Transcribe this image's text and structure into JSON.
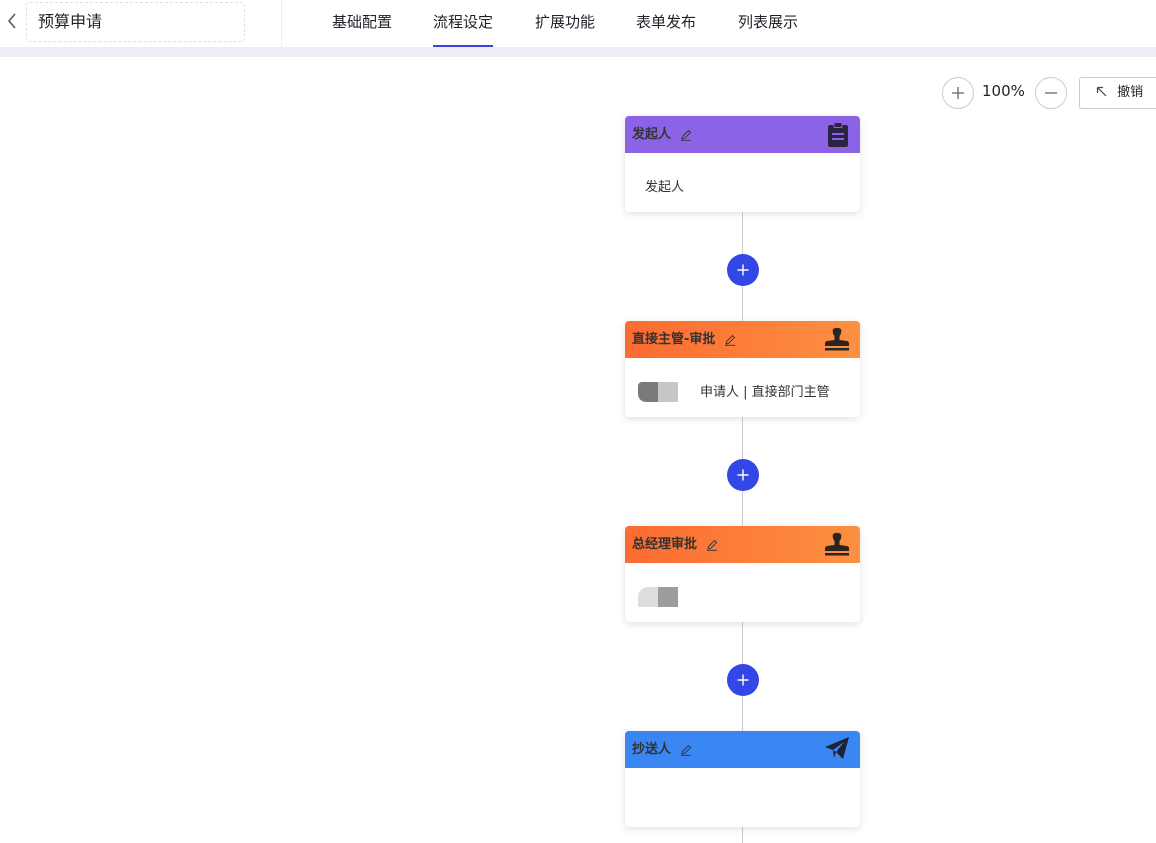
{
  "header": {
    "title": "预算申请",
    "tabs": [
      {
        "label": "基础配置",
        "active": false
      },
      {
        "label": "流程设定",
        "active": true
      },
      {
        "label": "扩展功能",
        "active": false
      },
      {
        "label": "表单发布",
        "active": false
      },
      {
        "label": "列表展示",
        "active": false
      }
    ],
    "accent_color": "#3d42d8"
  },
  "toolbar": {
    "zoom_level": "100%",
    "undo_label": "撤销"
  },
  "flow": {
    "add_button_color": "#3346e6",
    "nodes": [
      {
        "title": "发起人",
        "type": "initiator",
        "header_color": "#8c63e6",
        "icon": "clipboard-icon",
        "body": "发起人"
      },
      {
        "title": "直接主管-审批",
        "type": "approver",
        "header_color": "#fb6b32",
        "icon": "stamp-icon",
        "assignee": "申请人 | 直接部门主管"
      },
      {
        "title": "总经理审批",
        "type": "approver",
        "header_color": "#fb6b32",
        "icon": "stamp-icon",
        "assignee": ""
      },
      {
        "title": "抄送人",
        "type": "cc",
        "header_color": "#3a86f2",
        "icon": "paper-plane-icon",
        "body": ""
      }
    ]
  }
}
